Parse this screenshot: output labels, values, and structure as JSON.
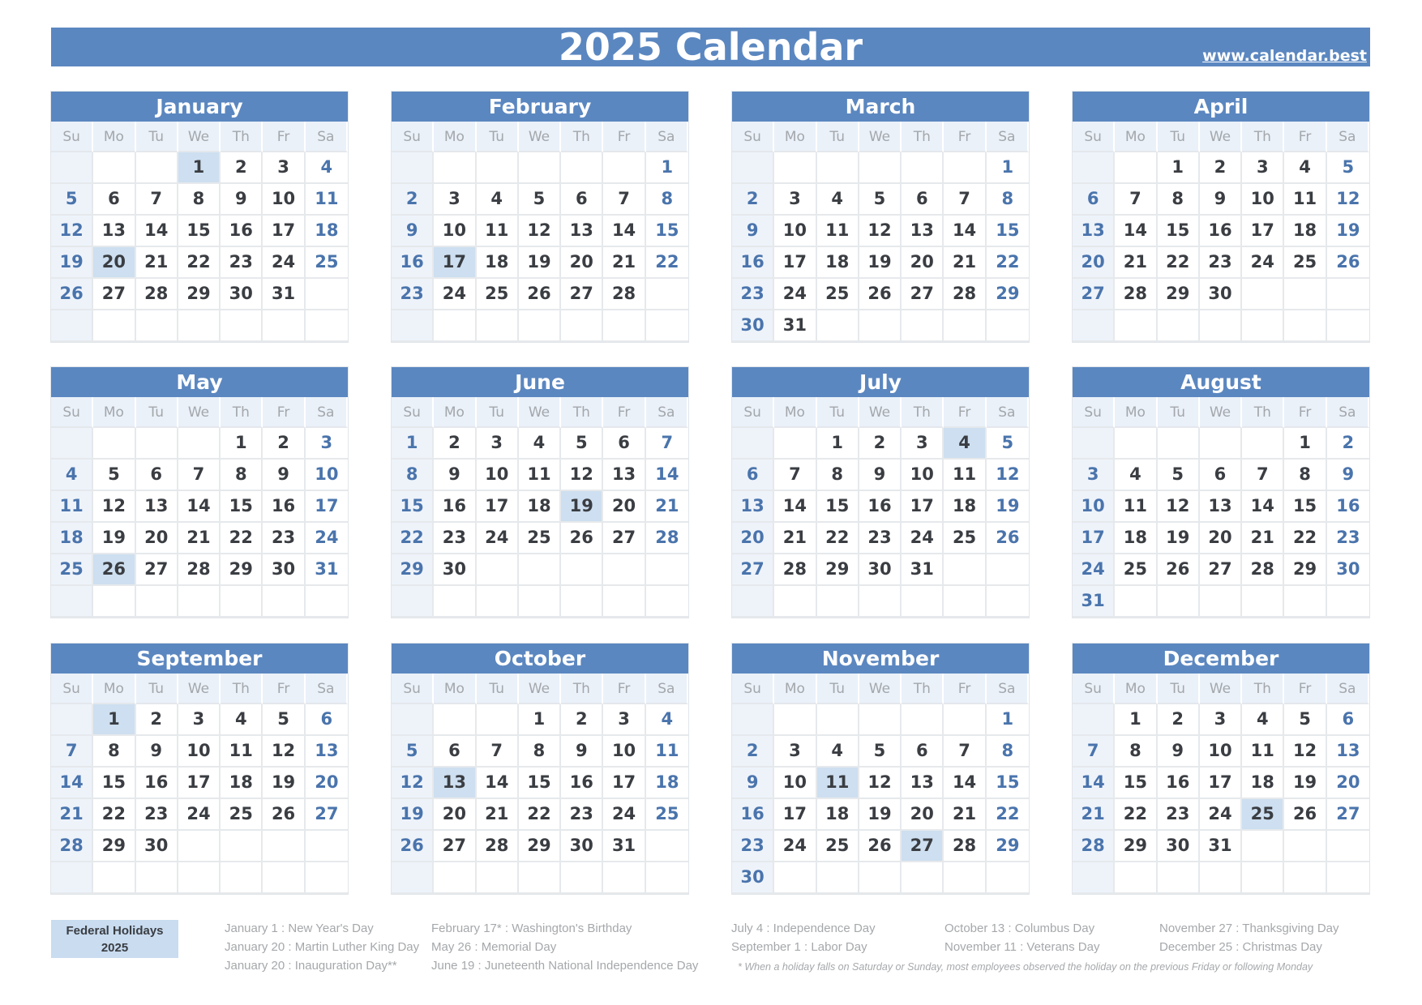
{
  "header": {
    "title": "2025 Calendar",
    "site_link": "www.calendar.best"
  },
  "colors": {
    "accent": "#5b87c0",
    "holiday_highlight": "#cddff0",
    "weekend_text": "#4a74ac",
    "weekday_text": "#3a3d42",
    "dow_header_bg": "#eaf1f9",
    "sunday_column_bg": "#eef3fa"
  },
  "weekdays": [
    "Su",
    "Mo",
    "Tu",
    "We",
    "Th",
    "Fr",
    "Sa"
  ],
  "months": [
    {
      "name": "January",
      "start": 3,
      "days": 31,
      "holidays": [
        1,
        20
      ]
    },
    {
      "name": "February",
      "start": 6,
      "days": 28,
      "holidays": [
        17
      ]
    },
    {
      "name": "March",
      "start": 6,
      "days": 31,
      "holidays": []
    },
    {
      "name": "April",
      "start": 2,
      "days": 30,
      "holidays": []
    },
    {
      "name": "May",
      "start": 4,
      "days": 31,
      "holidays": [
        26
      ]
    },
    {
      "name": "June",
      "start": 0,
      "days": 30,
      "holidays": [
        19
      ]
    },
    {
      "name": "July",
      "start": 2,
      "days": 31,
      "holidays": [
        4
      ]
    },
    {
      "name": "August",
      "start": 5,
      "days": 31,
      "holidays": []
    },
    {
      "name": "September",
      "start": 1,
      "days": 30,
      "holidays": [
        1
      ]
    },
    {
      "name": "October",
      "start": 3,
      "days": 31,
      "holidays": [
        13
      ]
    },
    {
      "name": "November",
      "start": 6,
      "days": 30,
      "holidays": [
        11,
        27
      ]
    },
    {
      "name": "December",
      "start": 1,
      "days": 31,
      "holidays": [
        25
      ]
    }
  ],
  "legend": {
    "title_line1": "Federal Holidays",
    "title_line2": "2025",
    "columns": [
      [
        "January 1 : New Year's Day",
        "January 20 : Martin Luther King Day",
        "January 20 : Inauguration Day**"
      ],
      [
        "February 17* : Washington's Birthday",
        "May 26 : Memorial Day",
        "June 19 : Juneteenth National Independence Day"
      ],
      [
        "July 4 : Independence Day",
        "September 1 : Labor Day"
      ],
      [
        "October 13 : Columbus Day",
        "November 11 : Veterans Day"
      ],
      [
        "November 27 : Thanksgiving Day",
        "December 25 : Christmas Day"
      ]
    ],
    "footnote": "* When a holiday falls on Saturday or Sunday, most employees observed the holiday on the previous Friday or following Monday"
  }
}
